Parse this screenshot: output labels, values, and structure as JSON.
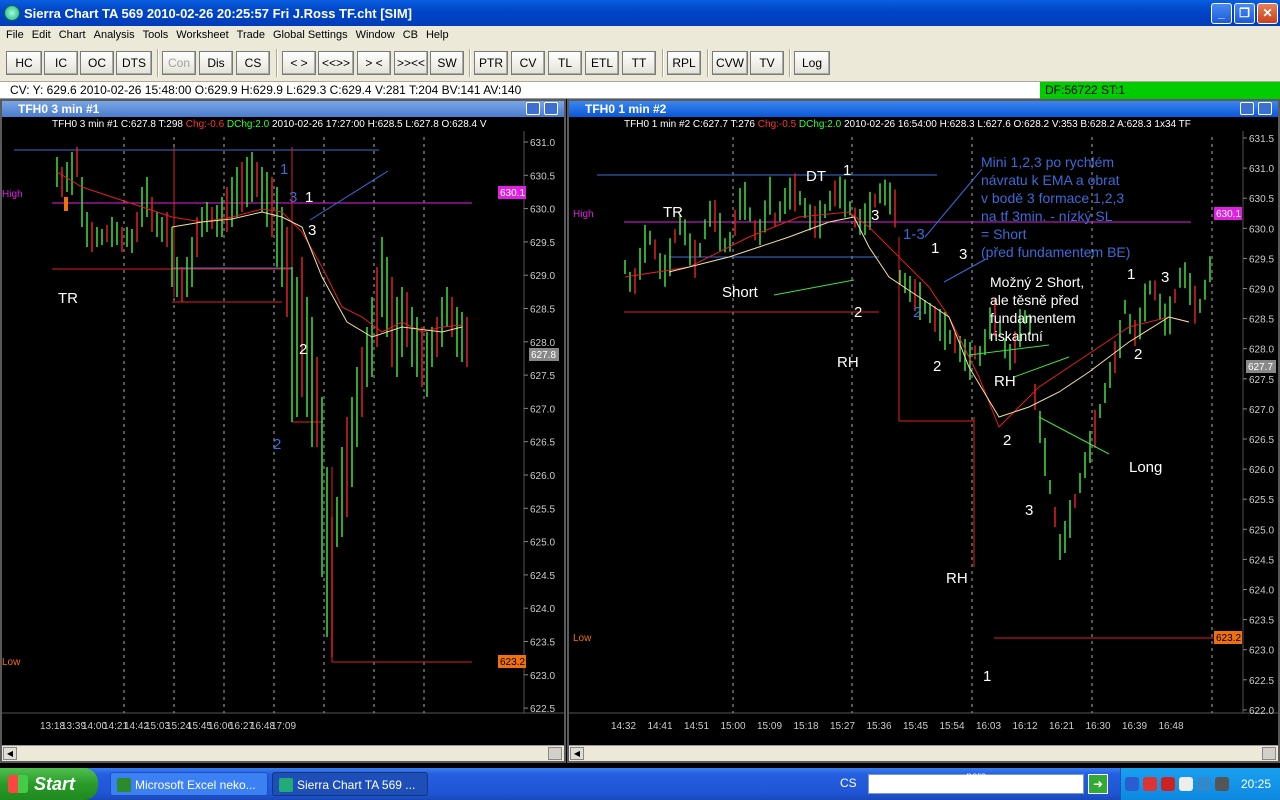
{
  "window": {
    "title": "Sierra Chart TA 569  2010-02-26  20:25:57  Fri    J.Ross TF.cht [SIM]"
  },
  "menu": [
    "File",
    "Edit",
    "Chart",
    "Analysis",
    "Tools",
    "Worksheet",
    "Trade",
    "Global Settings",
    "Window",
    "CB",
    "Help"
  ],
  "toolbar": [
    "HC",
    "IC",
    "OC",
    "DTS",
    "Con",
    "Dis",
    "CS",
    "< >",
    "<<>>",
    "> <",
    ">><<",
    "SW",
    "PTR",
    "CV",
    "TL",
    "ETL",
    "TT",
    "RPL",
    "CVW",
    "TV",
    "Log"
  ],
  "status": {
    "text": "CV: Y: 629.6  2010-02-26  15:48:00  O:629.9  H:629.9  L:629.3  C:629.4  V:281  T:204  BV:141  AV:140",
    "df": "DF:56722  ST:1"
  },
  "chart1": {
    "title": "TFH0  3 min  #1",
    "header_a": "TFH0  3 min  #1 C:627.8 T:298 ",
    "header_chg": "Chg:-0.6",
    "header_dchg": " DChg:2.0",
    "header_b": " 2010-02-26  17:27:00  H:628.5  L:627.8  O:628.4  V",
    "yticks": [
      "631.0",
      "630.5",
      "630.0",
      "629.5",
      "629.0",
      "628.5",
      "628.0",
      "627.5",
      "627.0",
      "626.5",
      "626.0",
      "625.5",
      "625.0",
      "624.5",
      "624.0",
      "623.5",
      "623.0",
      "622.5"
    ],
    "xticks": [
      "13:18",
      "13:39",
      "14:00",
      "14:21",
      "14:42",
      "15:03",
      "15:24",
      "15:45",
      "16:06",
      "16:27",
      "16:48",
      "17:09"
    ],
    "high_label": "High",
    "low_label": "Low",
    "high_value": "630.1",
    "low_value": "623.2",
    "last_value": "627.8",
    "annotations": [
      "1",
      "3",
      "1",
      "3",
      "TR",
      "2",
      "2"
    ]
  },
  "chart2": {
    "title": "TFH0  1 min   #2",
    "header_a": "TFH0  1 min   #2 C:627.7 T:276 ",
    "header_chg": "Chg:-0.5",
    "header_dchg": " DChg:2.0",
    "header_b": " 2010-02-26  16:54:00  H:628.3  L:627.6  O:628.2  V:353  B:628.2  A:628.3  1x34  TF",
    "yticks": [
      "631.5",
      "631.0",
      "630.5",
      "630.0",
      "629.5",
      "629.0",
      "628.5",
      "628.0",
      "627.5",
      "627.0",
      "626.5",
      "626.0",
      "625.5",
      "625.0",
      "624.5",
      "624.0",
      "623.5",
      "623.0",
      "622.5",
      "622.0"
    ],
    "xticks": [
      "14:32",
      "14:41",
      "14:51",
      "15:00",
      "15:09",
      "15:18",
      "15:27",
      "15:36",
      "15:45",
      "15:54",
      "16:03",
      "16:12",
      "16:21",
      "16:30",
      "16:39",
      "16:48"
    ],
    "high_label": "High",
    "low_label": "Low",
    "high_value": "630.1",
    "low_value": "623.2",
    "last_value": "627.7",
    "note_blue": [
      "Mini 1,2,3 po rychlém",
      "návratu k EMA a obrat",
      "v bodě 3 formace 1,2,3",
      "na tf 3min. - nízký SL",
      "= Short",
      "(před fundamentem BE)"
    ],
    "note_white": [
      "Možný 2 Short,",
      "ale těsně před",
      "fundamentem",
      "riskantní"
    ],
    "annotations": [
      "DT",
      "1",
      "TR",
      "3",
      "Short",
      "2",
      "RH",
      "1-3",
      "1",
      "3",
      "2",
      "2",
      "RH",
      "2",
      "3",
      "RH",
      "1",
      "1",
      "3",
      "2",
      "Long"
    ]
  },
  "taskbar": {
    "start": "Start",
    "tasks": [
      "Microsoft Excel neko...",
      "Sierra Chart TA 569  ..."
    ],
    "lang": "CS",
    "search_brand_top": "nero",
    "search_brand_bottom": "@SEARCH",
    "clock": "20:25"
  }
}
